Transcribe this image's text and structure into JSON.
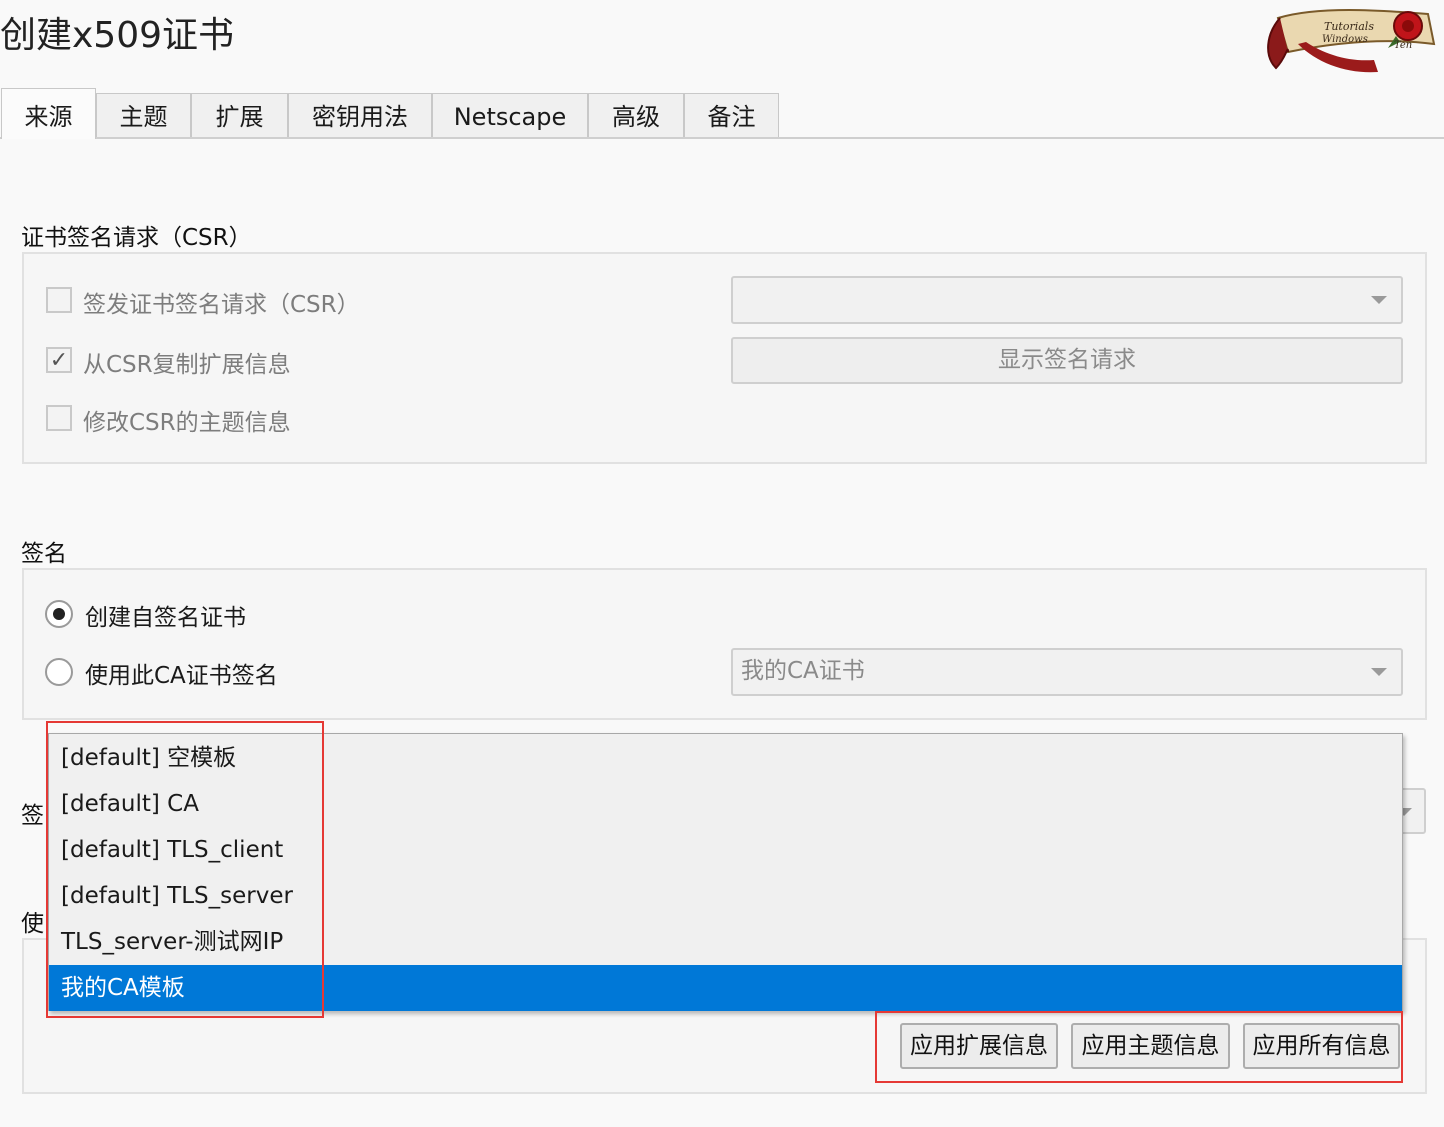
{
  "window": {
    "title": "创建x509证书"
  },
  "logo": {
    "line1": "Tutorials",
    "line2": "Windows",
    "line3": "Ten"
  },
  "tabs": [
    {
      "label": "来源",
      "active": true
    },
    {
      "label": "主题"
    },
    {
      "label": "扩展"
    },
    {
      "label": "密钥用法"
    },
    {
      "label": "Netscape"
    },
    {
      "label": "高级"
    },
    {
      "label": "备注"
    }
  ],
  "csr": {
    "heading": "证书签名请求（CSR）",
    "sign_csr": {
      "label": "签发证书签名请求（CSR）",
      "checked": false
    },
    "copy_ext": {
      "label": "从CSR复制扩展信息",
      "checked": true,
      "mark": "✓"
    },
    "modify_subject": {
      "label": "修改CSR的主题信息",
      "checked": false
    },
    "csr_select": {
      "value": ""
    },
    "show_request_button": "显示签名请求"
  },
  "signing": {
    "heading": "签名",
    "self_signed": {
      "label": "创建自签名证书",
      "selected": true
    },
    "use_ca": {
      "label": "使用此CA证书签名",
      "selected": false
    },
    "ca_select": {
      "value": "我的CA证书"
    }
  },
  "hidden_labels": {
    "sig_prefix": "签",
    "use_prefix": "使"
  },
  "template_dropdown": {
    "options": [
      "[default] 空模板",
      "[default] CA",
      "[default] TLS_client",
      "[default] TLS_server",
      "TLS_server-测试网IP",
      "我的CA模板"
    ],
    "selected_index": 5
  },
  "template_buttons": {
    "apply_extensions": "应用扩展信息",
    "apply_subject": "应用主题信息",
    "apply_all": "应用所有信息"
  },
  "colors": {
    "selection": "#0078d7",
    "highlight": "#e53935"
  }
}
